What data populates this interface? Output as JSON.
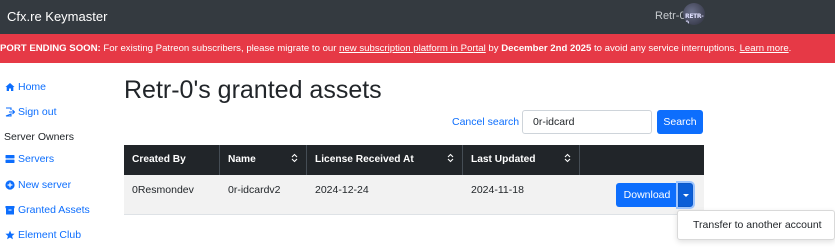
{
  "topbar": {
    "brand": "Cfx.re Keymaster",
    "user_name": "Retr-0",
    "avatar_text": "RETR-0"
  },
  "banner": {
    "lead": "PORT ENDING SOON:",
    "text1": " For existing Patreon subscribers, please migrate to our ",
    "link1": "new subscription platform in Portal",
    "text2": " by ",
    "date": "December 2nd 2025",
    "text3": " to avoid any service interruptions. ",
    "link2": "Learn more",
    "text4": ".",
    "color": "#e63946"
  },
  "sidebar": {
    "home": "Home",
    "sign_out": "Sign out",
    "heading": "Server Owners",
    "servers": "Servers",
    "new_server": "New server",
    "granted_assets": "Granted Assets",
    "element_club": "Element Club"
  },
  "page": {
    "title": "Retr-0's granted assets"
  },
  "search": {
    "cancel": "Cancel search",
    "value": "0r-idcard",
    "button": "Search"
  },
  "table": {
    "headers": [
      "Created By",
      "Name",
      "License Received At",
      "Last Updated"
    ],
    "rows": [
      {
        "created_by": "0Resmondev",
        "name": "0r-idcardv2",
        "license_received_at": "2024-12-24",
        "last_updated": "2024-11-18"
      }
    ]
  },
  "actions": {
    "download": "Download",
    "menu_item": "Transfer to another account"
  },
  "colors": {
    "primary": "#0d6efd",
    "dark": "#212529",
    "navbar": "#343a40"
  },
  "icons": {
    "home": "home-icon",
    "sign_out": "sign-out-icon",
    "servers": "server-icon",
    "new_server": "plus-circle-icon",
    "granted_assets": "box-icon",
    "element_club": "star-icon",
    "sort": "sort-icon",
    "caret": "caret-down-icon"
  }
}
